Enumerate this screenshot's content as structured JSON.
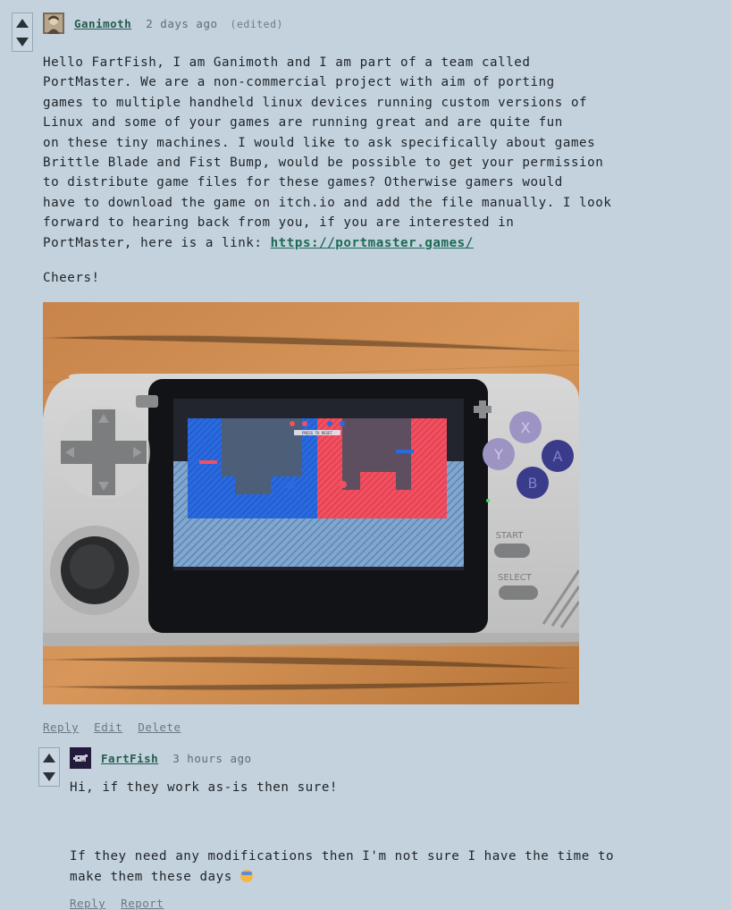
{
  "comment1": {
    "author": "Ganimoth",
    "time": "2 days ago",
    "edited": "(edited)",
    "paragraph1_lines": [
      "Hello FartFish, I am Ganimoth and I am part of a team called",
      "PortMaster. We are a non-commercial project with aim of porting",
      "games to multiple handheld linux devices running custom versions of",
      "Linux and some of your games are running great and are quite fun",
      "on these tiny machines. I would like to ask specifically about games",
      "Brittle Blade and Fist Bump, would be possible to get your permission",
      "to distribute game files for these games? Otherwise gamers would",
      "have to download the game on itch.io and add the file manually. I look",
      "forward to hearing back from you, if you are interested in"
    ],
    "last_line_prefix": "PortMaster, here is a link: ",
    "link": "https://portmaster.games/",
    "closing": "Cheers!",
    "actions": {
      "reply": "Reply",
      "edit": "Edit",
      "delete": "Delete"
    },
    "photo": {
      "buttons": {
        "x": "X",
        "y": "Y",
        "a": "A",
        "b": "B"
      },
      "start": "START",
      "select": "SELECT",
      "hud": "PRESS TO RESET"
    }
  },
  "comment2": {
    "author": "FartFish",
    "time": "3 hours ago",
    "line1": "Hi, if they work as-is then sure!",
    "line2": "If they need any modifications then I'm not sure I have the time to",
    "line3": "make them these days",
    "actions": {
      "reply": "Reply",
      "report": "Report"
    }
  },
  "colors": {
    "background": "#c4d2de",
    "link": "#1d6a55",
    "author": "#245c4c"
  }
}
